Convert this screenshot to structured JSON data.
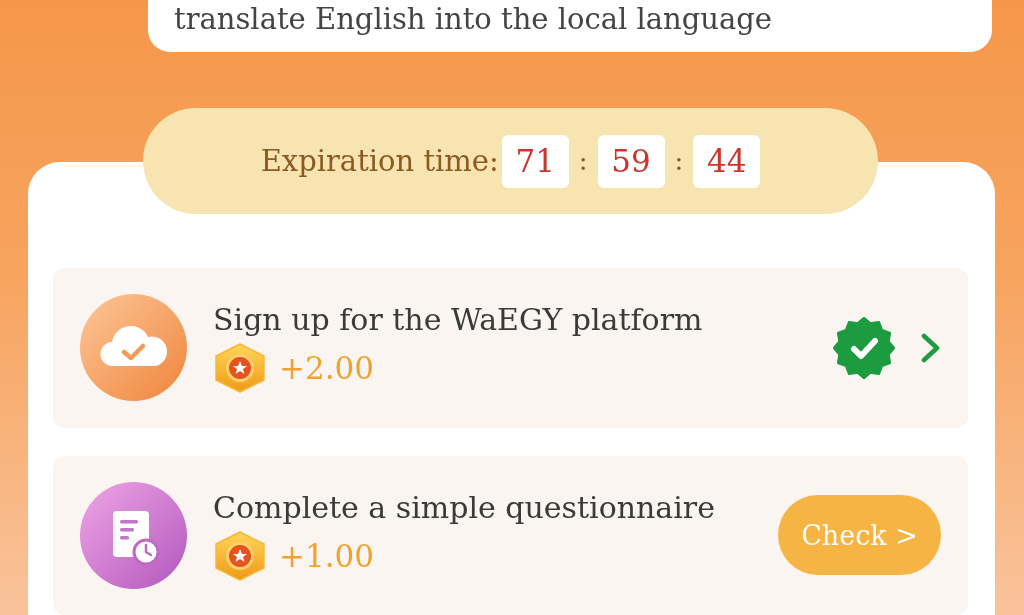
{
  "header_card": {
    "text": "translate English into the local language"
  },
  "countdown": {
    "label": "Expiration time:",
    "segments": [
      "71",
      "59",
      "44"
    ],
    "separators": [
      ":",
      ":"
    ]
  },
  "tasks": [
    {
      "kind": "signup",
      "title": "Sign up for the WaEGY platform",
      "reward": "+2.00",
      "completed": true
    },
    {
      "kind": "questionnaire",
      "title": "Complete a simple questionnaire",
      "reward": "+1.00",
      "completed": false,
      "action": "Check >"
    }
  ]
}
